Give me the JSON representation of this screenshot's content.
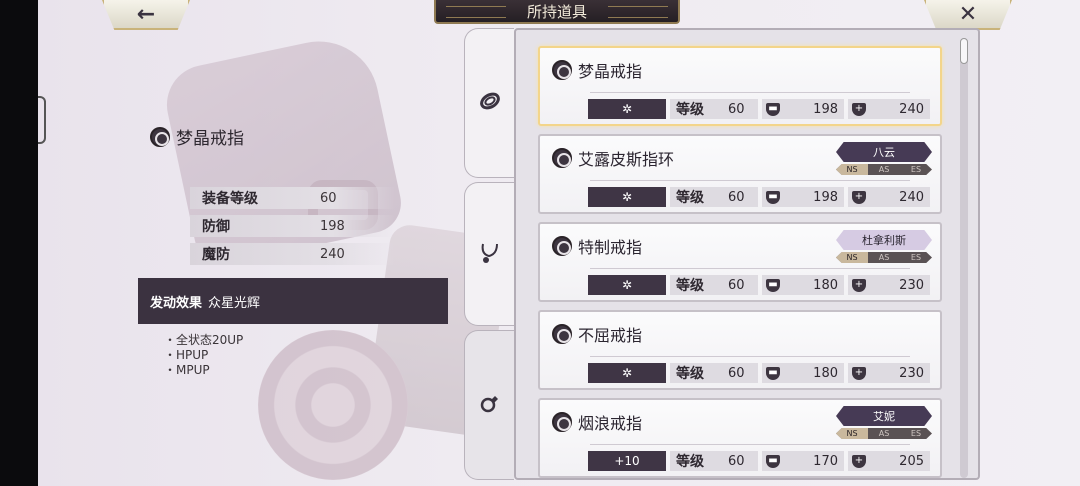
{
  "header": {
    "title": "所持道具",
    "back_icon": "←",
    "close_icon": "✕"
  },
  "detail": {
    "name": "梦晶戒指",
    "stats": [
      {
        "label": "装备等级",
        "value": "60"
      },
      {
        "label": "防御",
        "value": "198"
      },
      {
        "label": "魔防",
        "value": "240"
      }
    ],
    "effect_label": "发动效果",
    "effect_name": "众星光辉",
    "effects": [
      "・全状态20UP",
      "・HPUP",
      "・MPUP"
    ]
  },
  "tabs": [
    {
      "icon": "bracelet-icon"
    },
    {
      "icon": "necklace-icon"
    },
    {
      "icon": "ring-icon"
    }
  ],
  "list": {
    "level_label": "等级",
    "items": [
      {
        "name": "梦晶戒指",
        "enhance": "✲",
        "level": "60",
        "def": "198",
        "mdef": "240",
        "char": "",
        "selected": true
      },
      {
        "name": "艾露皮斯指环",
        "enhance": "✲",
        "level": "60",
        "def": "198",
        "mdef": "240",
        "char": "八云",
        "types": [
          "NS",
          "AS",
          "ES"
        ]
      },
      {
        "name": "特制戒指",
        "enhance": "✲",
        "level": "60",
        "def": "180",
        "mdef": "230",
        "char": "杜拿利斯",
        "types": [
          "NS",
          "AS",
          "ES"
        ]
      },
      {
        "name": "不屈戒指",
        "enhance": "✲",
        "level": "60",
        "def": "180",
        "mdef": "230",
        "char": ""
      },
      {
        "name": "烟浪戒指",
        "enhance": "+10",
        "level": "60",
        "def": "170",
        "mdef": "205",
        "char": "艾妮",
        "types": [
          "NS",
          "AS",
          "ES"
        ]
      }
    ]
  }
}
